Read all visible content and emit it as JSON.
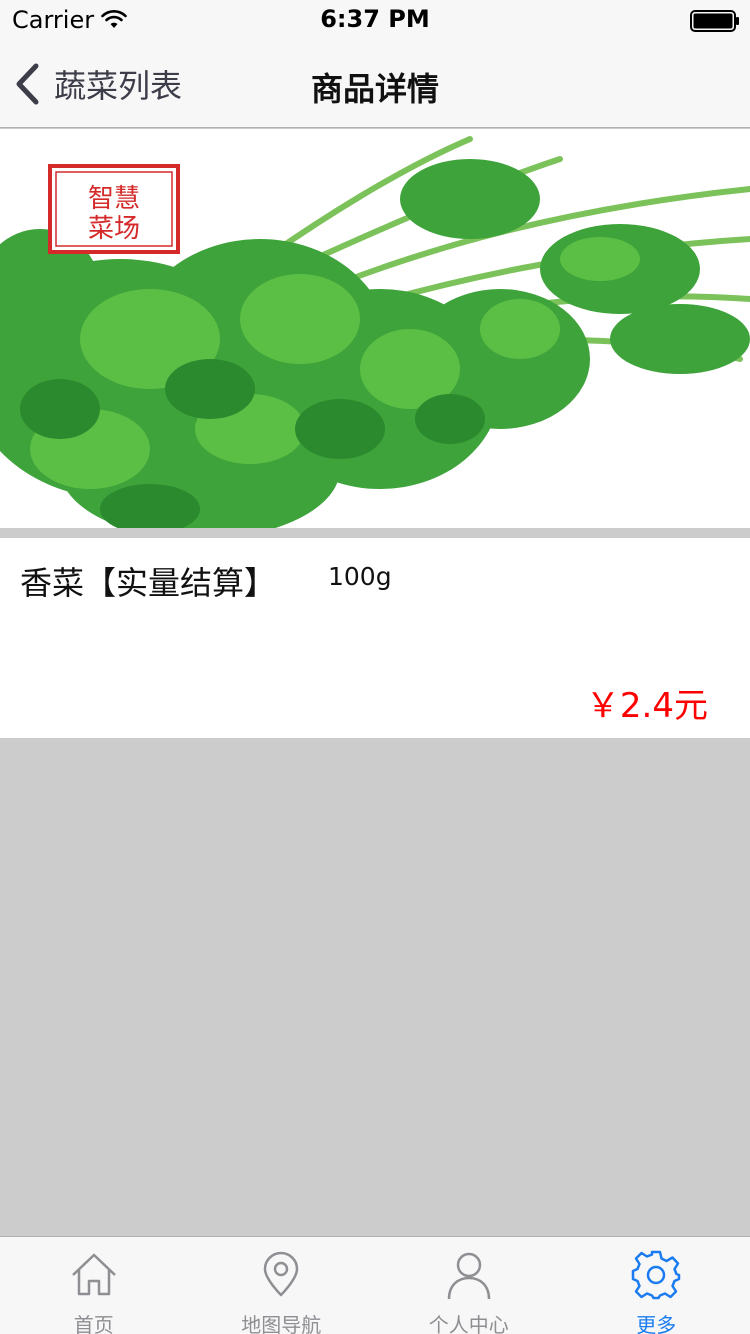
{
  "status_bar": {
    "carrier": "Carrier",
    "time": "6:37 PM",
    "icons": [
      "wifi-icon",
      "battery-icon"
    ]
  },
  "nav": {
    "back_label": "蔬菜列表",
    "title": "商品详情",
    "back_icon": "chevron-left-icon"
  },
  "product": {
    "image_stamp_text": "智慧菜场",
    "name": "香菜【实量结算】",
    "weight": "100g",
    "price": "￥2.4元"
  },
  "tab_bar": {
    "active_color": "#1a7cf0",
    "inactive_color": "#8e8e93",
    "items": [
      {
        "label": "首页",
        "icon": "home-icon",
        "active": false
      },
      {
        "label": "地图导航",
        "icon": "map-pin-icon",
        "active": false
      },
      {
        "label": "个人中心",
        "icon": "person-icon",
        "active": false
      },
      {
        "label": "更多",
        "icon": "gear-icon",
        "active": true
      }
    ]
  },
  "colors": {
    "price": "#ff0000",
    "background": "#cccccc",
    "bar_background": "#f7f7f7"
  }
}
